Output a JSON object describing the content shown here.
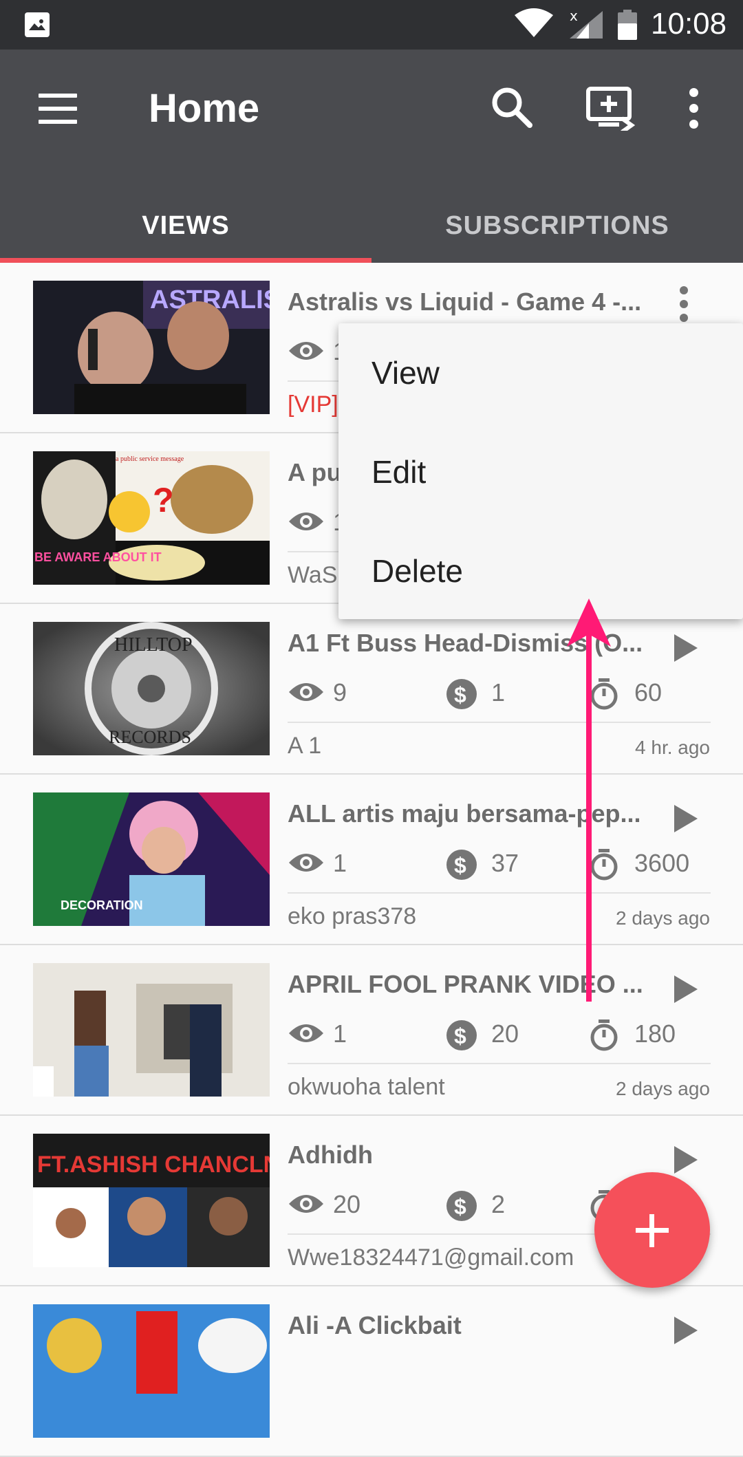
{
  "status_bar": {
    "time": "10:08"
  },
  "app_bar": {
    "title": "Home"
  },
  "tabs": [
    {
      "label": "VIEWS"
    },
    {
      "label": "SUBSCRIPTIONS"
    }
  ],
  "videos": [
    {
      "title": "Astralis vs Liquid - Game 4 -...",
      "views": "1",
      "earnings": "",
      "duration": "",
      "author": "[VIP]",
      "ago": ""
    },
    {
      "title": "A pu",
      "views": "1",
      "earnings": "",
      "duration": "",
      "author": "WaS",
      "ago": ""
    },
    {
      "title": "A1 Ft Buss Head-Dismiss (O...",
      "views": "9",
      "earnings": "1",
      "duration": "60",
      "author": "A 1",
      "ago": "4 hr. ago"
    },
    {
      "title": "ALL artis maju bersama-pep...",
      "views": "1",
      "earnings": "37",
      "duration": "3600",
      "author": "eko pras378",
      "ago": "2 days ago"
    },
    {
      "title": "APRIL FOOL PRANK VIDEO ...",
      "views": "1",
      "earnings": "20",
      "duration": "180",
      "author": "okwuoha talent",
      "ago": "2 days ago"
    },
    {
      "title": "Adhidh",
      "views": "20",
      "earnings": "2",
      "duration": "",
      "author": "Wwe18324471@gmail.com",
      "ago": ""
    },
    {
      "title": "Ali -A Clickbait",
      "views": "",
      "earnings": "",
      "duration": "",
      "author": "",
      "ago": ""
    }
  ],
  "popup_menu": {
    "items": [
      "View",
      "Edit",
      "Delete"
    ]
  },
  "thumbnail_text": {
    "v1": "ASTRALIS",
    "v2_top": "a public service message",
    "v2_bottom": "BE AWARE ABOUT IT",
    "v3_top": "HILLTOP",
    "v3_bottom": "RECORDS",
    "v4": "DECORATION",
    "v6": "FT.ASHISH CHANCLNI"
  },
  "colors": {
    "accent": "#f0505a",
    "appbar": "#4a4b4f",
    "statusbar": "#2f3033",
    "arrow": "#ff1a75",
    "vip": "#e53935"
  }
}
